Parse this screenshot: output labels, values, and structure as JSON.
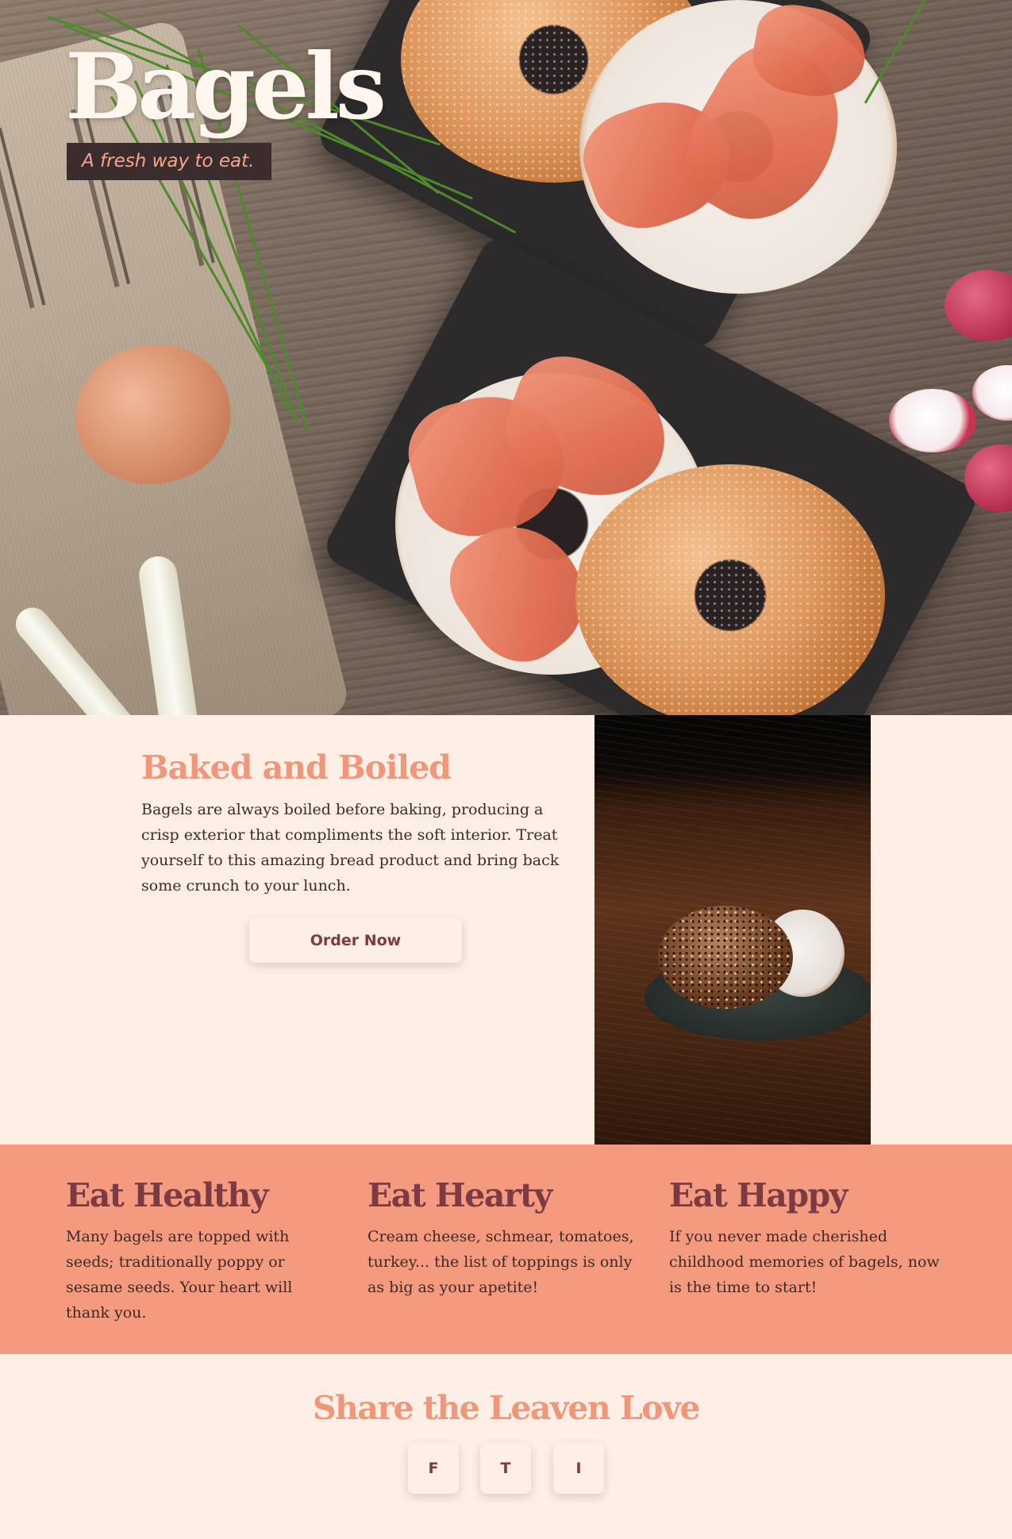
{
  "hero": {
    "title": "Bagels",
    "tagline": "A fresh way to eat."
  },
  "feature": {
    "title": "Baked and Boiled",
    "text": "Bagels are always boiled before baking, producing a crisp exterior that compliments the soft interior. Treat yourself to this amazing bread product and bring back some crunch to your lunch.",
    "button_label": "Order Now"
  },
  "highlights": [
    {
      "title": "Eat Healthy",
      "text": "Many bagels are topped with seeds; traditionally poppy or sesame seeds. Your heart will thank you."
    },
    {
      "title": "Eat Hearty",
      "text": "Cream cheese, schmear, tomatoes, turkey... the list of toppings is only as big as your apetite!"
    },
    {
      "title": "Eat Happy",
      "text": "If you never made cherished childhood memories of bagels, now is the time to start!"
    }
  ],
  "share": {
    "title": "Share the Leaven Love",
    "buttons": [
      "F",
      "T",
      "I"
    ]
  },
  "colors": {
    "background": "#fdeee6",
    "accent_salmon": "#f49a7e",
    "heading_salmon": "#f0977a",
    "heading_burgundy": "#7c3a43",
    "tag_background": "#3b2d2e",
    "body_text": "#3b2a2a"
  }
}
